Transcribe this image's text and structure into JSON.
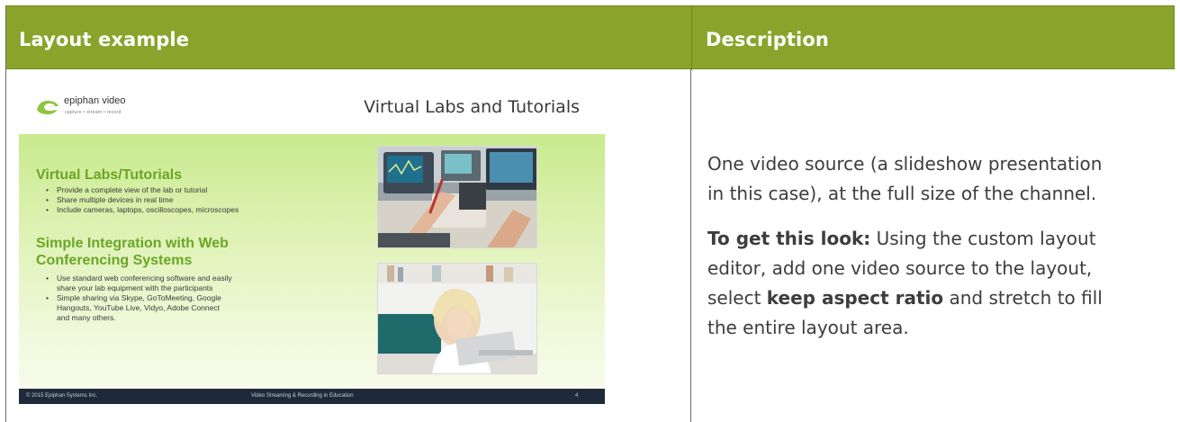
{
  "table": {
    "headers": {
      "left": "Layout example",
      "right": "Description"
    }
  },
  "slide": {
    "logo": {
      "brand": "epiphan video",
      "tagline": "capture • stream • record"
    },
    "title": "Virtual Labs and Tutorials",
    "section1": {
      "heading": "Virtual Labs/Tutorials",
      "bullets": [
        "Provide a complete view of the lab or tutorial",
        "Share multiple devices in real time",
        "Include cameras, laptops, oscilloscopes, microscopes"
      ]
    },
    "section2": {
      "heading_line1": "Simple Integration with Web",
      "heading_line2": "Conferencing Systems",
      "bullets": [
        {
          "line1": "Use standard web conferencing software and easily",
          "line2": "share your lab equipment with the participants"
        },
        {
          "line1": "Simple sharing via Skype, GoToMeeting, Google",
          "line2": "Hangouts, YouTube Live, Vidyo, Adobe Connect",
          "line3": "and many others."
        }
      ]
    },
    "footer": {
      "copyright": "© 2015 Epiphan Systems Inc.",
      "center": "Video Streaming & Recording in Education",
      "page": "4"
    }
  },
  "description": {
    "para1_line1": "One video source (a slideshow presentation",
    "para1_line2": "in this case), at the full size of the channel.",
    "para2_bold1": "To get this look:",
    "para2_text1": " Using the custom layout",
    "para2_line2": "editor, add one video source to the layout,",
    "para2_text3a": "select ",
    "para2_bold2": "keep aspect ratio",
    "para2_text3b": " and stretch to fill",
    "para2_line4": "the entire layout area."
  },
  "colors": {
    "header_bg": "#8aa42b",
    "header_text": "#ffffff",
    "slide_heading": "#6aa626",
    "slide_footer": "#1e2a3a"
  }
}
